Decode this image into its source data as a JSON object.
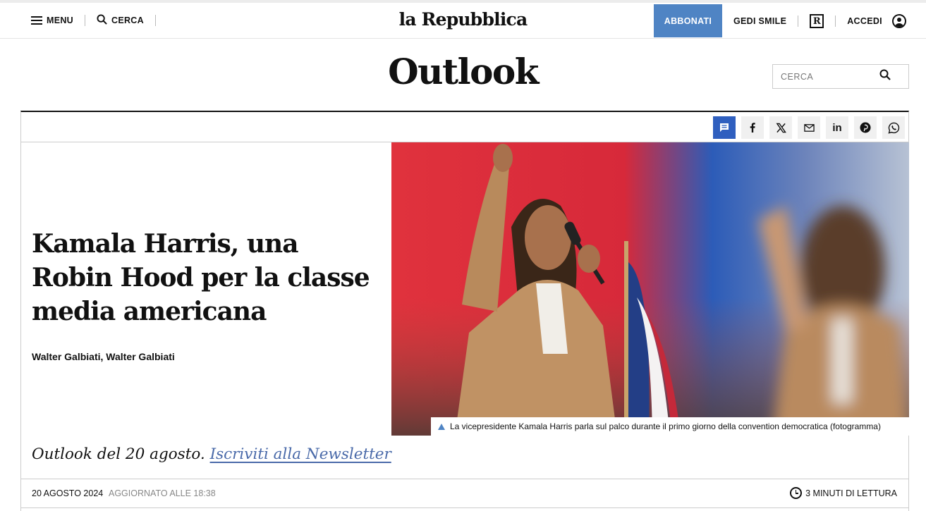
{
  "header": {
    "menu_label": "MENU",
    "search_label": "CERCA",
    "logo_text": "la Repubblica",
    "subscribe_label": "ABBONATI",
    "gedi_label": "GEDI SMILE",
    "r_icon_text": "R",
    "login_label": "ACCEDI"
  },
  "section": {
    "title": "Outlook",
    "search_placeholder": "CERCA"
  },
  "share": {
    "icons": [
      "comment-icon",
      "facebook-icon",
      "x-icon",
      "email-icon",
      "linkedin-icon",
      "pinterest-icon",
      "whatsapp-icon"
    ],
    "comment_color": "#2f5fbf"
  },
  "article": {
    "headline": "Kamala Harris, una Robin Hood per la classe media americana",
    "authors": "Walter Galbiati, Walter Galbiati",
    "photo_caption": "La vicepresidente Kamala Harris parla sul palco durante il primo giorno della convention democratica (fotogramma)",
    "summary_text": "Outlook del 20 agosto.",
    "summary_link": "Iscriviti alla Newsletter",
    "date": "20 AGOSTO 2024",
    "updated": "AGGIORNATO ALLE 18:38",
    "reading_time": "3 MINUTI DI LETTURA"
  },
  "colors": {
    "accent": "#4f84c4",
    "link": "#4a6aa9"
  }
}
